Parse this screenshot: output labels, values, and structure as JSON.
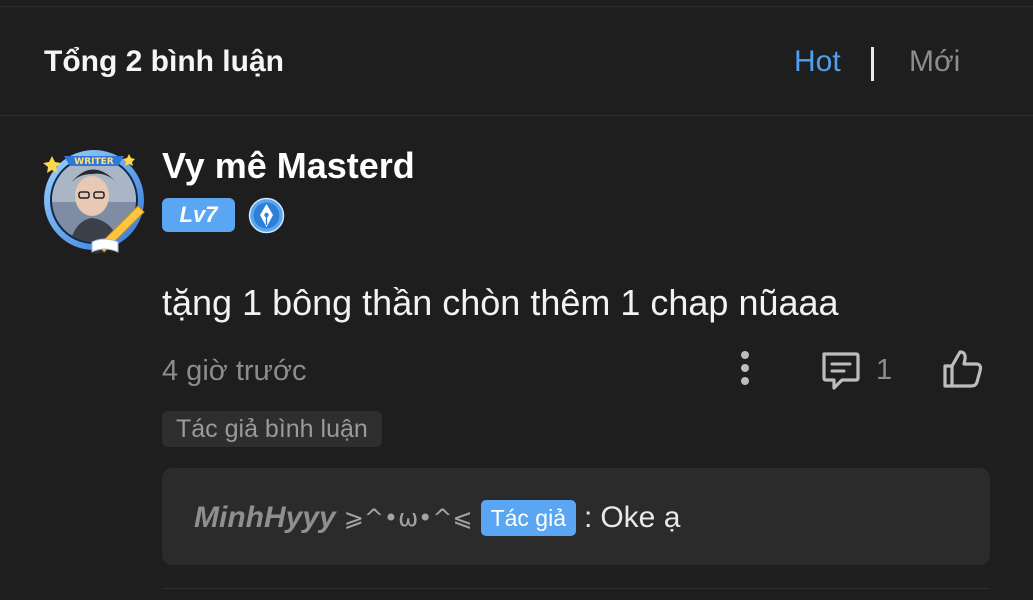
{
  "header": {
    "title": "Tổng 2 bình luận",
    "sort_hot": "Hot",
    "sort_new": "Mới",
    "active_sort": "Hot"
  },
  "comment": {
    "author": "Vy mê Masterd",
    "avatar_frame_label": "WRITER",
    "level": "Lv7",
    "badge_icon": "pen-nib-icon",
    "text": "tặng 1 bông thần chòn thêm 1 chap nũaaa",
    "time": "4 giờ trước",
    "reply_count": "1",
    "tag": "Tác giả bình luận"
  },
  "reply": {
    "user": "MinhHyyy",
    "kaomoji": "⩾^•ω•^⩽",
    "tag": "Tác giả",
    "separator": ":",
    "text": "Oke ạ"
  },
  "colors": {
    "background": "#1e1e1e",
    "accent": "#4da0f0",
    "badge": "#5aa6f3",
    "muted": "#8c8c8c"
  }
}
